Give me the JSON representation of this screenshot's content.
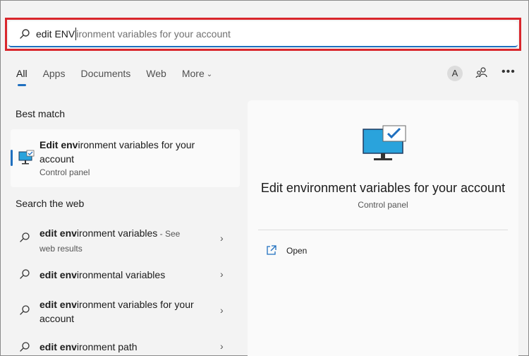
{
  "search": {
    "typed": "edit ENV",
    "suggestion": "ironment variables for your account"
  },
  "tabs": [
    {
      "label": "All",
      "active": true
    },
    {
      "label": "Apps"
    },
    {
      "label": "Documents"
    },
    {
      "label": "Web"
    },
    {
      "label": "More"
    }
  ],
  "toolbar": {
    "avatar_letter": "A"
  },
  "best_match": {
    "section_label": "Best match",
    "title_bold": "Edit env",
    "title_rest": "ironment variables for your account",
    "subtitle": "Control panel"
  },
  "web": {
    "section_label": "Search the web",
    "items": [
      {
        "bold": "edit env",
        "rest": "ironment variables",
        "suffix": " - See web results"
      },
      {
        "bold": "edit env",
        "rest": "ironmental variables",
        "suffix": ""
      },
      {
        "bold": "edit env",
        "rest": "ironment variables for your account",
        "suffix": ""
      },
      {
        "bold": "edit env",
        "rest": "ironment path",
        "suffix": ""
      }
    ]
  },
  "preview": {
    "title": "Edit environment variables for your account",
    "subtitle": "Control panel",
    "action_open": "Open"
  },
  "icons": {
    "search": "search-icon",
    "people": "people-icon",
    "more": "more-icon",
    "monitor": "monitor-check-icon",
    "open": "open-external-icon",
    "chevron": "chevron-right-icon"
  },
  "colors": {
    "accent": "#1f6fbf",
    "highlight_border": "#d9262c"
  }
}
